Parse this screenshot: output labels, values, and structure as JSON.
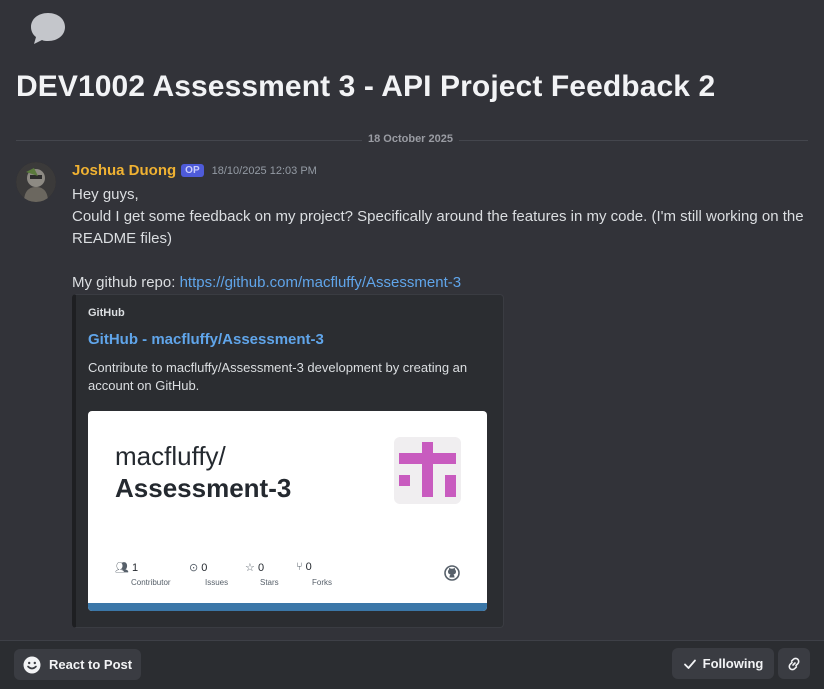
{
  "post": {
    "title": "DEV1002 Assessment 3 - API Project Feedback 2",
    "date_divider": "18 October 2025"
  },
  "message": {
    "author": "Joshua Duong",
    "badge": "OP",
    "timestamp": "18/10/2025 12:03 PM",
    "text_intro": "Hey guys,\nCould I get some feedback on my project? Specifically around the features in my code. (I'm still working on the README files)\n\nMy github repo: ",
    "link_text": "https://github.com/macfluffy/Assessment-3"
  },
  "embed": {
    "provider": "GitHub",
    "title": "GitHub - macfluffy/Assessment-3",
    "description": "Contribute to macfluffy/Assessment-3 development by creating an account on GitHub.",
    "card": {
      "owner": "macfluffy/",
      "repo": "Assessment-3",
      "stats": [
        {
          "icon": "people-icon",
          "num": "1",
          "label": "Contributor"
        },
        {
          "icon": "issue-icon",
          "num": "0",
          "label": "Issues"
        },
        {
          "icon": "star-icon",
          "num": "0",
          "label": "Stars"
        },
        {
          "icon": "fork-icon",
          "num": "0",
          "label": "Forks"
        }
      ]
    }
  },
  "footer": {
    "react_label": "React to Post",
    "follow_label": "Following"
  },
  "colors": {
    "background": "#323339",
    "username": "#f0b232",
    "link": "#60a5ea",
    "op_badge": "#4e5bd9",
    "embed_bar": "#3b77a8",
    "repo_avatar": "#c85bbf"
  }
}
